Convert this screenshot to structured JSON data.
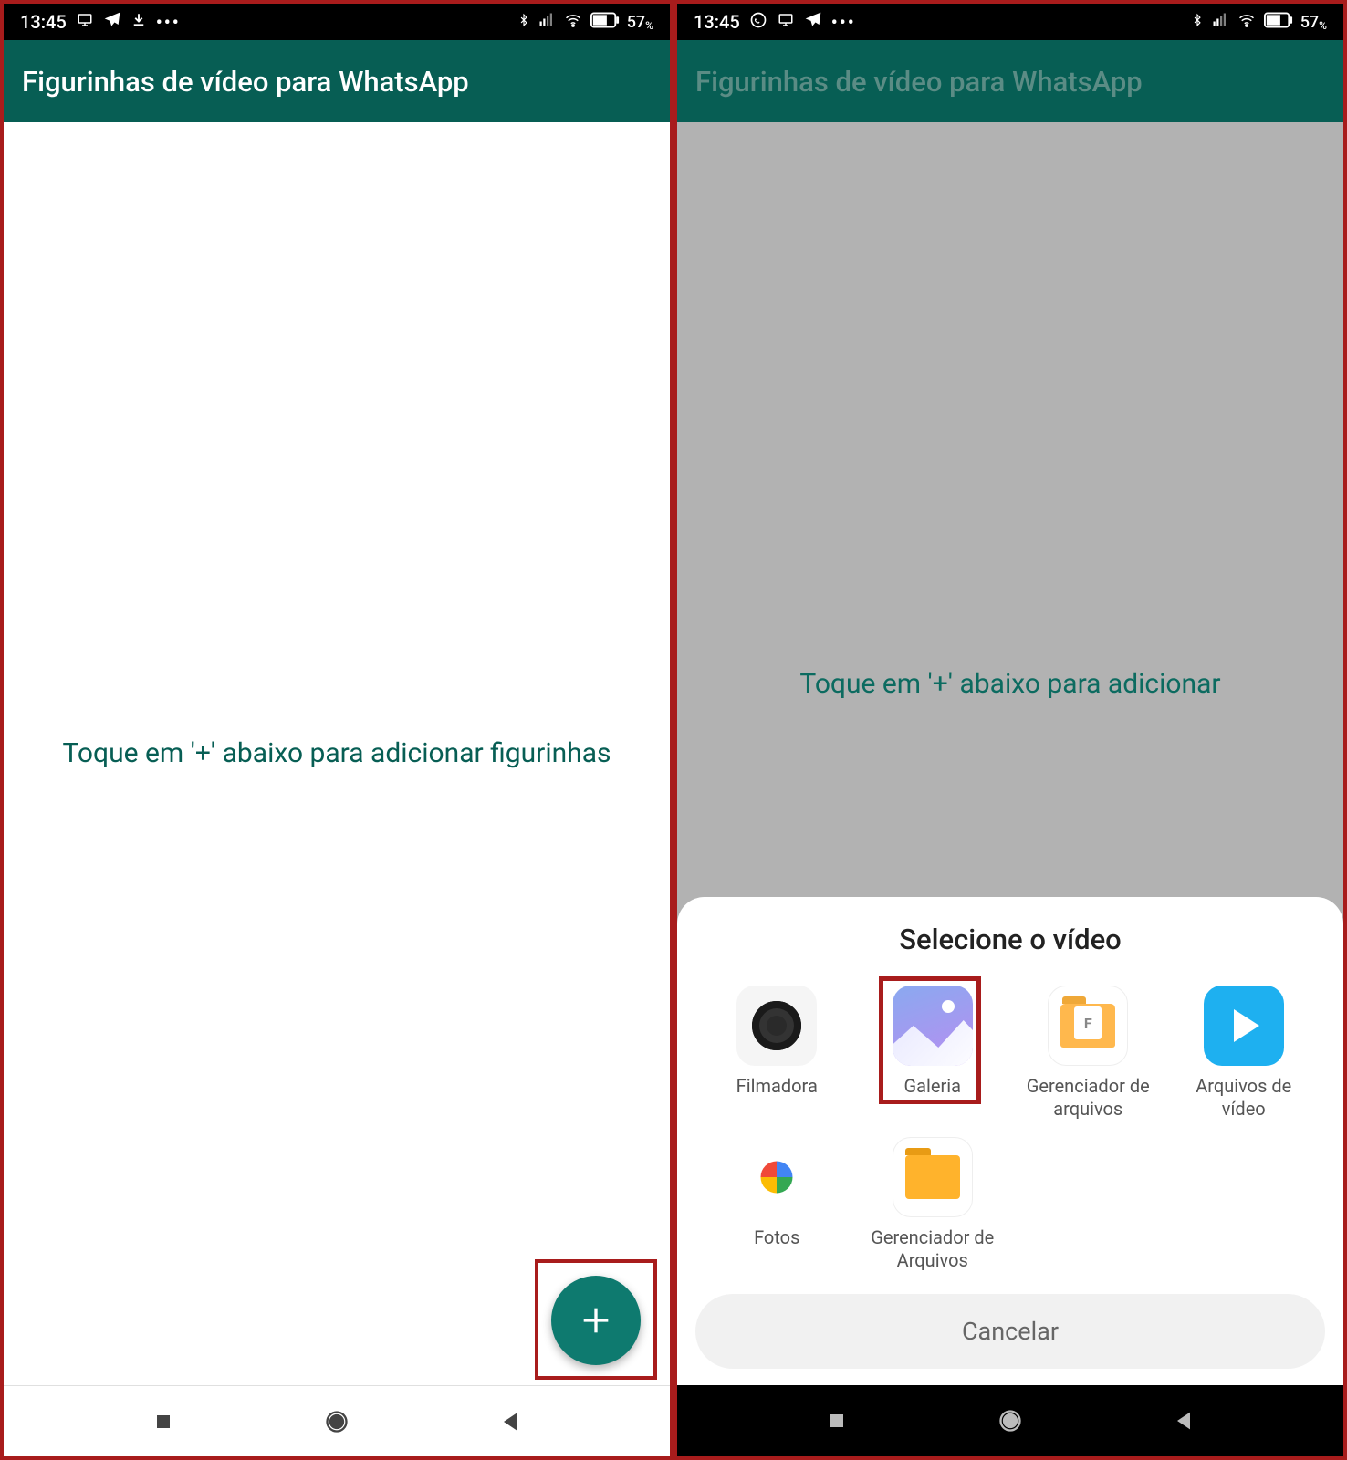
{
  "status": {
    "time": "13:45",
    "battery": "57"
  },
  "header": {
    "title": "Figurinhas de vídeo para WhatsApp"
  },
  "content": {
    "hint": "Toque em '+' abaixo para adicionar figurinhas",
    "hint_partial": "Toque em '+' abaixo para adicionar"
  },
  "sheet": {
    "title": "Selecione o vídeo",
    "items": [
      {
        "label": "Filmadora"
      },
      {
        "label": "Galeria"
      },
      {
        "label": "Gerenciador de arquivos"
      },
      {
        "label": "Arquivos de vídeo"
      },
      {
        "label": "Fotos"
      },
      {
        "label": "Gerenciador de Arquivos"
      }
    ],
    "cancel": "Cancelar"
  }
}
